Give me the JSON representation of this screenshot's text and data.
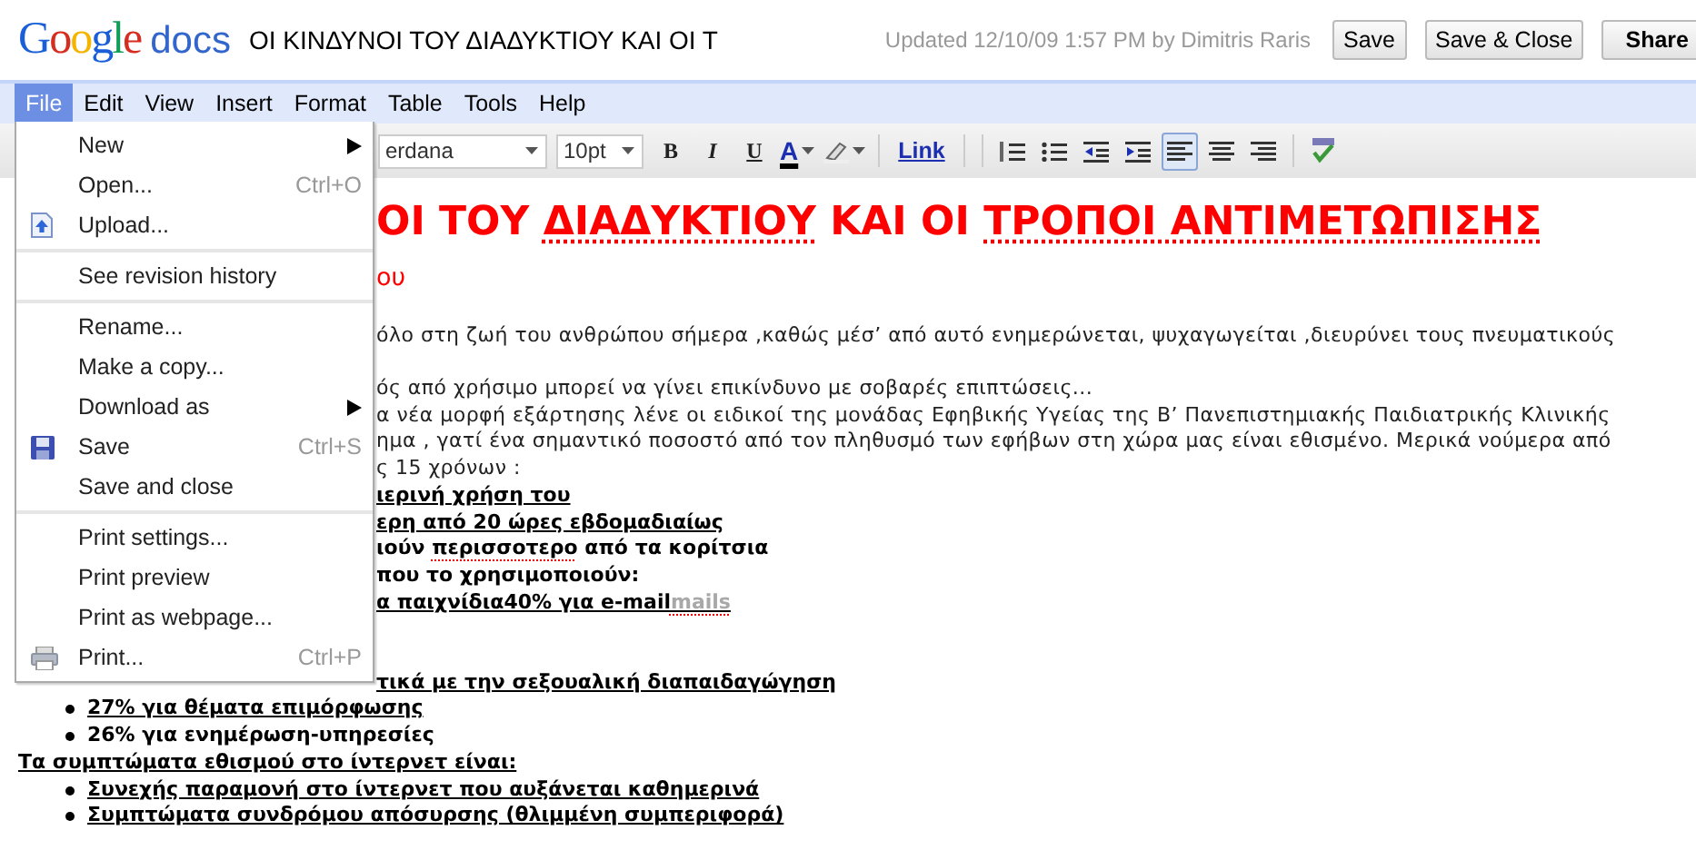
{
  "header": {
    "logo": {
      "brand": "Google",
      "product": "docs"
    },
    "doc_title": "ΟΙ ΚΙΝΔΥΝΟΙ ΤΟΥ ΔΙΑΔΥΚΤΙΟΥ ΚΑΙ ΟΙ Τ",
    "updated": "Updated 12/10/09 1:57 PM by Dimitris Raris",
    "buttons": [
      {
        "label": "Save",
        "kind": "plain"
      },
      {
        "label": "Save & Close",
        "kind": "plain"
      },
      {
        "label": "Share",
        "kind": "menu"
      }
    ]
  },
  "menubar": [
    {
      "label": "File",
      "selected": true
    },
    {
      "label": "Edit",
      "selected": false
    },
    {
      "label": "View",
      "selected": false
    },
    {
      "label": "Insert",
      "selected": false
    },
    {
      "label": "Format",
      "selected": false
    },
    {
      "label": "Table",
      "selected": false
    },
    {
      "label": "Tools",
      "selected": false
    },
    {
      "label": "Help",
      "selected": false
    }
  ],
  "toolbar": {
    "font": "erdana",
    "size": "10pt",
    "items": [
      {
        "kind": "bold",
        "label": "B"
      },
      {
        "kind": "italic",
        "label": "I"
      },
      {
        "kind": "underline",
        "label": "U"
      },
      {
        "kind": "text-color",
        "label": "A"
      },
      {
        "kind": "highlight"
      },
      {
        "kind": "link",
        "label": "Link"
      },
      {
        "kind": "numbered-list"
      },
      {
        "kind": "bulleted-list"
      },
      {
        "kind": "outdent"
      },
      {
        "kind": "indent"
      },
      {
        "kind": "align-left",
        "selected": true
      },
      {
        "kind": "align-center",
        "selected": false
      },
      {
        "kind": "align-right",
        "selected": false
      },
      {
        "kind": "spellcheck"
      }
    ]
  },
  "file_menu": [
    {
      "kind": "item",
      "label": "New",
      "submenu": true
    },
    {
      "kind": "item",
      "label": "Open...",
      "shortcut": "Ctrl+O"
    },
    {
      "kind": "upload-item",
      "label": "Upload..."
    },
    {
      "kind": "separator"
    },
    {
      "kind": "item",
      "label": "See revision history"
    },
    {
      "kind": "separator"
    },
    {
      "kind": "item",
      "label": "Rename..."
    },
    {
      "kind": "item",
      "label": "Make a copy..."
    },
    {
      "kind": "item",
      "label": "Download as",
      "submenu": true
    },
    {
      "kind": "save-item",
      "label": "Save",
      "shortcut": "Ctrl+S"
    },
    {
      "kind": "item",
      "label": "Save and close"
    },
    {
      "kind": "separator"
    },
    {
      "kind": "item",
      "label": "Print settings..."
    },
    {
      "kind": "item",
      "label": "Print preview"
    },
    {
      "kind": "item",
      "label": "Print as webpage..."
    },
    {
      "kind": "print-item",
      "label": "Print...",
      "shortcut": "Ctrl+P"
    }
  ],
  "document": {
    "lines": [
      {
        "kind": "title",
        "covered": true,
        "segments": [
          {
            "text": "ΟΙ ΤΟΥ ",
            "misspelled": false
          },
          {
            "text": "ΔΙΑΔΥΚΤΙΟΥ",
            "misspelled": true
          },
          {
            "text": " ΚΑΙ ΟΙ ",
            "misspelled": false
          },
          {
            "text": "ΤΡΟΠΟΙ ΑΝΤΙΜΕΤΩΠΙΣΗΣ",
            "misspelled": true
          }
        ]
      },
      {
        "kind": "subtitle",
        "covered": true,
        "text": "ου"
      },
      {
        "kind": "blank"
      },
      {
        "kind": "body",
        "covered": true,
        "text": "όλο στη ζωή του ανθρώπου σήμερα ,καθώς μέσ’ από αυτό ενημερώνεται, ψυχαγωγείται ,διευρύνει τους πνευματικούς"
      },
      {
        "kind": "blank"
      },
      {
        "kind": "body",
        "covered": true,
        "text": "ός από χρήσιμο μπορεί να γίνει επικίνδυνο με σοβαρές επιπτώσεις..."
      },
      {
        "kind": "body",
        "covered": true,
        "text": "α νέα μορφή εξάρτησης λένε οι ειδικοί της μονάδας Εφηβικής Υγείας της Β’ Πανεπιστημιακής Παιδιατρικής Κλινικής"
      },
      {
        "kind": "body",
        "covered": true,
        "text": "ημα , γατί ένα σημαντικό ποσοστό από τον πληθυσμό των εφήβων στη χώρα μας είναι εθισμένο. Μερικά νούμερα από"
      },
      {
        "kind": "body",
        "covered": true,
        "text": "ς 15 χρόνων :"
      },
      {
        "kind": "strong",
        "covered": true,
        "underlined": true,
        "text": "ιερινή χρήση του"
      },
      {
        "kind": "strong",
        "covered": true,
        "underlined": true,
        "text": "ερη από 20 ώρες εβδομαδιαίως"
      },
      {
        "kind": "strong",
        "covered": true,
        "underlined": false,
        "segments": [
          {
            "text": "ιούν ",
            "misspelled": false
          },
          {
            "text": "περισσοτερο",
            "misspelled": true
          },
          {
            "text": " από τα κορίτσια",
            "misspelled": false
          }
        ]
      },
      {
        "kind": "strong",
        "covered": true,
        "underlined": false,
        "text": "που το χρησιμοποιούν:"
      },
      {
        "kind": "strong",
        "covered": true,
        "underlined": true,
        "segments": [
          {
            "text": "α παιχνίδια40% για e-mail",
            "misspelled": false,
            "faded": false
          },
          {
            "text": "mails",
            "misspelled": true,
            "faded": true
          }
        ]
      },
      {
        "kind": "blank"
      },
      {
        "kind": "blank"
      },
      {
        "kind": "strong",
        "covered": true,
        "underlined": true,
        "text": "τικά με την σεξουαλική διαπαιδαγώγηση"
      },
      {
        "kind": "bullet",
        "covered": false,
        "underlined": true,
        "text": "27% για θέματα επιμόρφωσης"
      },
      {
        "kind": "bullet",
        "covered": false,
        "underlined": false,
        "text": "26% για ενημέρωση-υπηρεσίες"
      },
      {
        "kind": "strong",
        "covered": false,
        "underlined": true,
        "text": "Τα συμπτώματα εθισμού στο ίντερνετ είναι:"
      },
      {
        "kind": "bullet",
        "covered": false,
        "underlined": true,
        "text": "Συνεχής παραμονή στο ίντερνετ που αυξάνεται καθημερινά"
      },
      {
        "kind": "bullet",
        "covered": false,
        "underlined": true,
        "text": "Συμπτώματα συνδρόμου απόσυρσης (θλιμμένη συμπεριφορά)"
      }
    ]
  }
}
